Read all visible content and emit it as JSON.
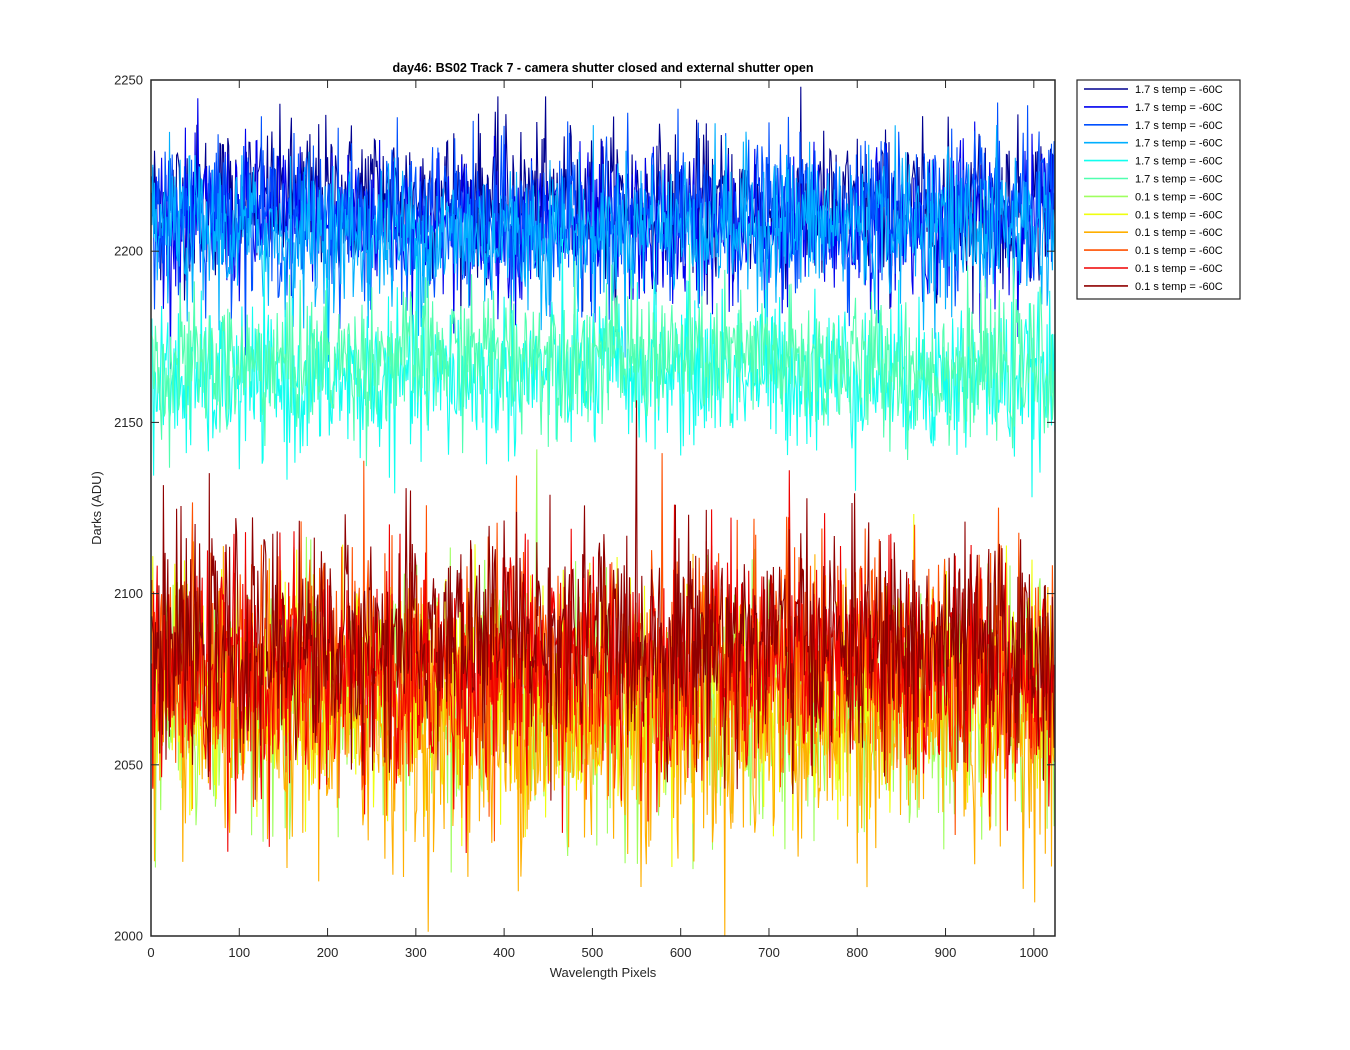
{
  "chart_data": {
    "type": "line",
    "title": "day46: BS02  Track 7 - camera shutter closed and external shutter open",
    "xlabel": "Wavelength Pixels",
    "ylabel": "Darks (ADU)",
    "xlim": [
      0,
      1024
    ],
    "ylim": [
      2000,
      2250
    ],
    "x_ticks": [
      0,
      100,
      200,
      300,
      400,
      500,
      600,
      700,
      800,
      900,
      1000
    ],
    "y_ticks": [
      2000,
      2050,
      2100,
      2150,
      2200,
      2250
    ],
    "grid": false,
    "legend_position": "outside-top-right",
    "x_range": {
      "start": 1,
      "end": 1024,
      "step": 1
    },
    "series": [
      {
        "name": "1.7 s temp = -60C",
        "color": "#00008f",
        "mean": 2214,
        "spread": 11
      },
      {
        "name": "1.7 s temp = -60C",
        "color": "#0000ef",
        "mean": 2208,
        "spread": 11
      },
      {
        "name": "1.7 s temp = -60C",
        "color": "#0050ff",
        "mean": 2210,
        "spread": 11
      },
      {
        "name": "1.7 s temp = -60C",
        "color": "#00afff",
        "mean": 2206,
        "spread": 11
      },
      {
        "name": "1.7 s temp = -60C",
        "color": "#10ffef",
        "mean": 2163,
        "spread": 11
      },
      {
        "name": "1.7 s temp = -60C",
        "color": "#50ffaf",
        "mean": 2168,
        "spread": 10
      },
      {
        "name": "0.1 s temp = -60C",
        "color": "#9fff60",
        "mean": 2068,
        "spread": 17
      },
      {
        "name": "0.1 s temp = -60C",
        "color": "#efff10",
        "mean": 2072,
        "spread": 17
      },
      {
        "name": "0.1 s temp = -60C",
        "color": "#ffaf00",
        "mean": 2062,
        "spread": 18
      },
      {
        "name": "0.1 s temp = -60C",
        "color": "#ff5000",
        "mean": 2080,
        "spread": 17
      },
      {
        "name": "0.1 s temp = -60C",
        "color": "#ef0000",
        "mean": 2078,
        "spread": 17
      },
      {
        "name": "0.1 s temp = -60C",
        "color": "#8f0000",
        "mean": 2086,
        "spread": 16
      }
    ]
  }
}
